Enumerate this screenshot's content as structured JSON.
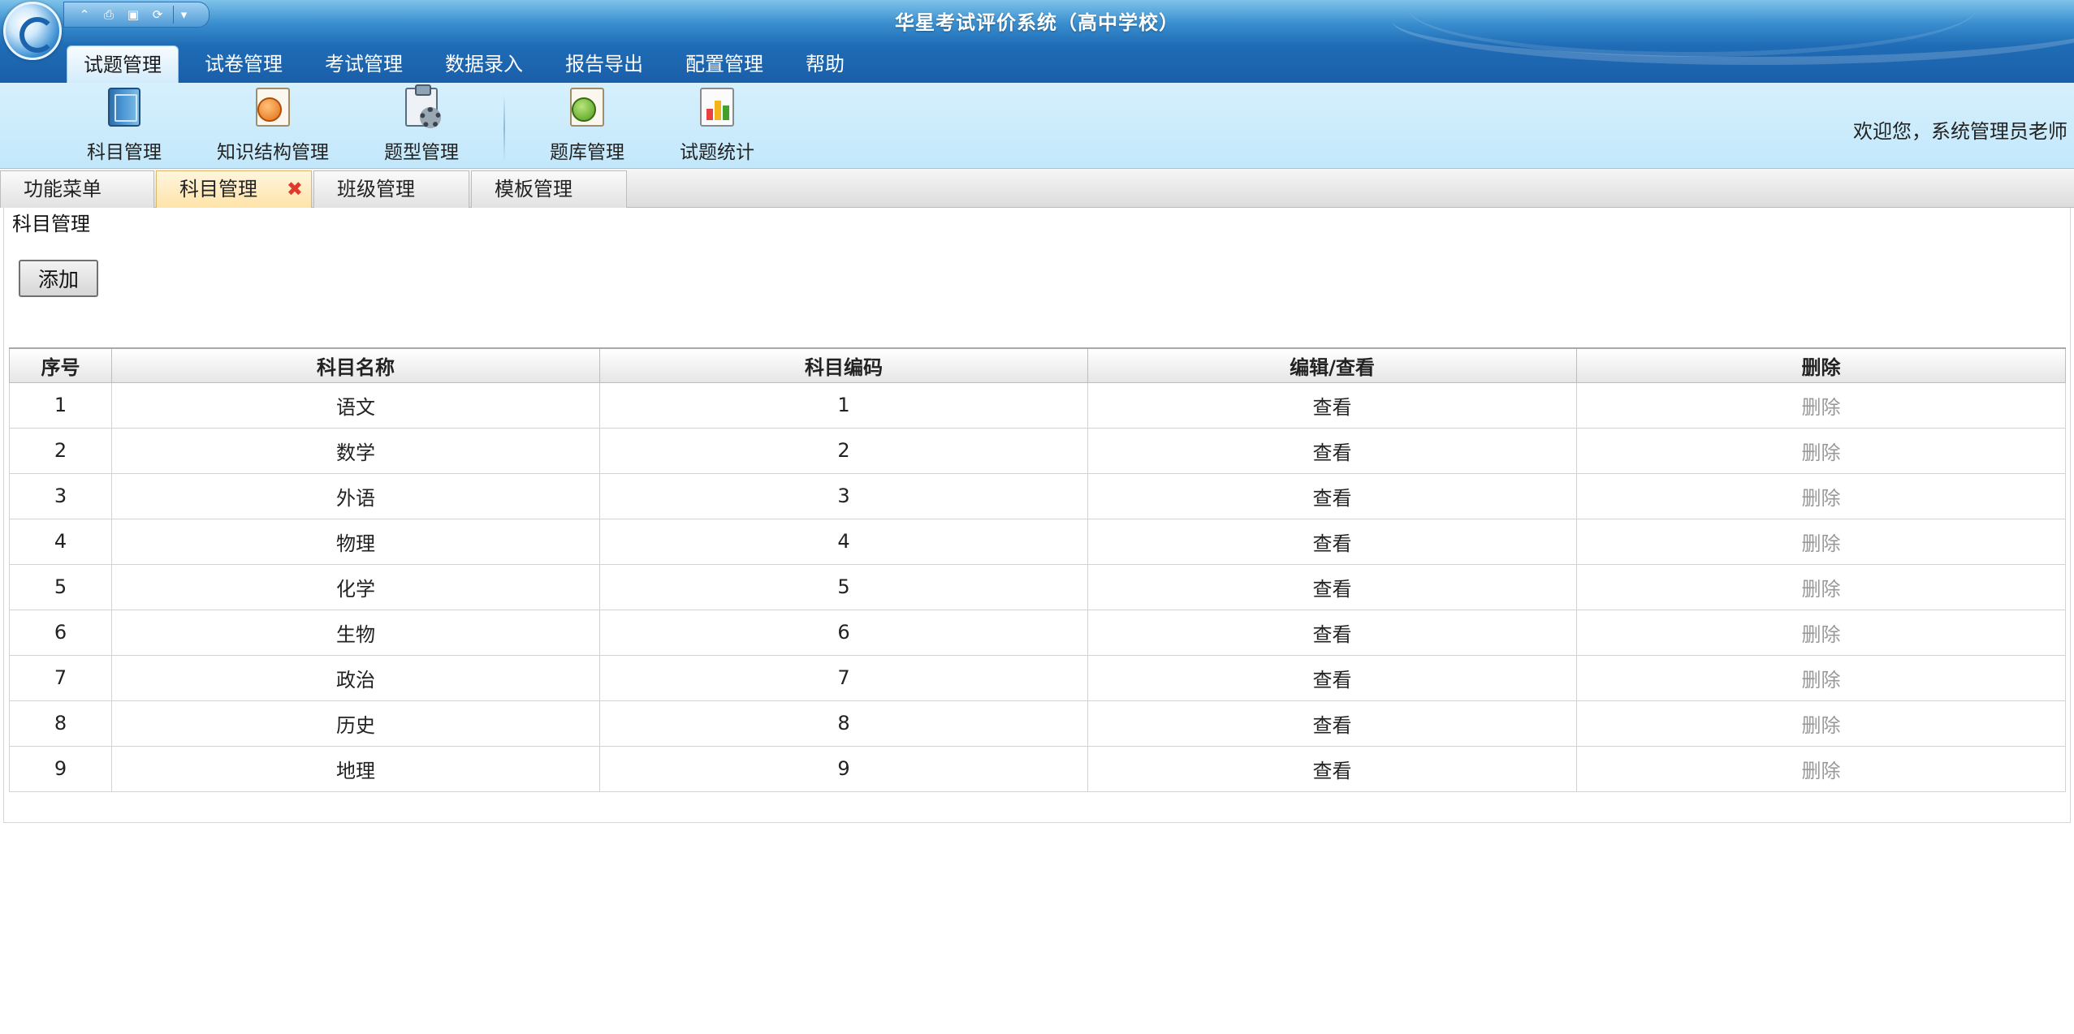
{
  "window": {
    "title": "华星考试评价系统（高中学校）",
    "quick_toolbar": [
      "⌃",
      "⎙",
      "▣",
      "⟳",
      "▾"
    ]
  },
  "ribbon_tabs": [
    {
      "label": "试题管理",
      "active": true
    },
    {
      "label": "试卷管理",
      "active": false
    },
    {
      "label": "考试管理",
      "active": false
    },
    {
      "label": "数据录入",
      "active": false
    },
    {
      "label": "报告导出",
      "active": false
    },
    {
      "label": "配置管理",
      "active": false
    },
    {
      "label": "帮助",
      "active": false
    }
  ],
  "ribbon_buttons": [
    {
      "label": "科目管理",
      "icon": "book-icon"
    },
    {
      "label": "知识结构管理",
      "icon": "knowledge-doc-icon"
    },
    {
      "label": "题型管理",
      "icon": "clipboard-gear-icon"
    },
    {
      "label": "题库管理",
      "icon": "question-bank-icon"
    },
    {
      "label": "试题统计",
      "icon": "bar-chart-icon"
    }
  ],
  "welcome": "欢迎您，系统管理员老师",
  "doc_tabs": [
    {
      "label": "功能菜单",
      "active": false
    },
    {
      "label": "科目管理",
      "active": true,
      "close": "✖"
    },
    {
      "label": "班级管理",
      "active": false
    },
    {
      "label": "模板管理",
      "active": false
    }
  ],
  "panel": {
    "title": "科目管理",
    "add_label": "添加"
  },
  "table": {
    "columns": [
      "序号",
      "科目名称",
      "科目编码",
      "编辑/查看",
      "删除"
    ],
    "rows": [
      {
        "index": "1",
        "name": "语文",
        "code": "1",
        "view": "查看",
        "delete": "删除"
      },
      {
        "index": "2",
        "name": "数学",
        "code": "2",
        "view": "查看",
        "delete": "删除"
      },
      {
        "index": "3",
        "name": "外语",
        "code": "3",
        "view": "查看",
        "delete": "删除"
      },
      {
        "index": "4",
        "name": "物理",
        "code": "4",
        "view": "查看",
        "delete": "删除"
      },
      {
        "index": "5",
        "name": "化学",
        "code": "5",
        "view": "查看",
        "delete": "删除"
      },
      {
        "index": "6",
        "name": "生物",
        "code": "6",
        "view": "查看",
        "delete": "删除"
      },
      {
        "index": "7",
        "name": "政治",
        "code": "7",
        "view": "查看",
        "delete": "删除"
      },
      {
        "index": "8",
        "name": "历史",
        "code": "8",
        "view": "查看",
        "delete": "删除"
      },
      {
        "index": "9",
        "name": "地理",
        "code": "9",
        "view": "查看",
        "delete": "删除"
      }
    ]
  },
  "colors": {
    "title_blue": "#1f6cb6",
    "ribbon_bg": "#c3e8fb",
    "active_doc_tab": "#ffe3a8",
    "close_red": "#e23a2a",
    "disabled_text": "#999999"
  }
}
